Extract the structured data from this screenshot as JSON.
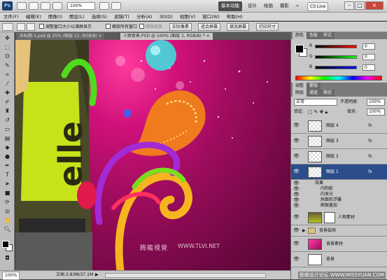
{
  "app": {
    "logo": "Ps",
    "zoom": "100%",
    "workspace_buttons": [
      "基本功能",
      "设计",
      "绘画",
      "摄影"
    ],
    "workspace_more": "»",
    "cs_live": "CS Live",
    "window_controls": [
      "–",
      "□",
      "×"
    ]
  },
  "menu": [
    "文件(F)",
    "编辑(E)",
    "图像(I)",
    "图层(L)",
    "选择(S)",
    "滤镜(T)",
    "分析(A)",
    "3D(D)",
    "视图(V)",
    "窗口(W)",
    "帮助(H)"
  ],
  "options": {
    "checkbox_resize": "调整窗口大小以满屏显示",
    "checkbox_all_windows": "缩放所有窗口",
    "checkbox_scrubby": "细微缩放",
    "btn_actual": "实际像素",
    "btn_fit": "适合屏幕",
    "btn_fill": "填充屏幕",
    "btn_print": "打印尺寸"
  },
  "documents": [
    {
      "label": "未标题-1.psd @ 25% (图层 11, RGB/8)",
      "close": "×"
    },
    {
      "label": "人物背景.PSD @ 100% (图层 1, RGB/8) *",
      "close": "×"
    }
  ],
  "canvas": {
    "watermark_left": "腾龍視覺",
    "watermark_right": "WWW.TLVI.NET",
    "shirt_text": "elle"
  },
  "status": {
    "zoom": "100%",
    "doc_info": "文档:3.83M/37.1M",
    "arrow": "▶"
  },
  "color_panel": {
    "tabs": [
      "颜色",
      "色板",
      "样式"
    ],
    "sliders": [
      {
        "label": "R",
        "value": "0"
      },
      {
        "label": "G",
        "value": "0"
      },
      {
        "label": "B",
        "value": "0"
      }
    ]
  },
  "layers_panel": {
    "top_tabs": [
      "调整",
      "蒙版"
    ],
    "tabs": [
      "图层",
      "通道",
      "路径"
    ],
    "blend_mode": "正常",
    "opacity_label": "不透明度:",
    "opacity_value": "100%",
    "lock_label": "锁定:",
    "fill_label": "填充:",
    "fill_value": "100%",
    "layers": [
      {
        "name": "图层 4",
        "fx": "fx",
        "thumb": "checker",
        "selected": false
      },
      {
        "name": "图层 3",
        "fx": "fx",
        "thumb": "checker",
        "selected": false
      },
      {
        "name": "图层 2",
        "fx": "fx",
        "thumb": "checker",
        "selected": false
      },
      {
        "name": "图层 1",
        "fx": "fx",
        "thumb": "checker",
        "selected": true
      }
    ],
    "effects_label": "效果",
    "effects": [
      "内阴影",
      "内发光",
      "斜面和浮雕",
      "图案叠加"
    ],
    "person_layer": "人物素材",
    "group_layer": "背景装饰",
    "bg_material": "背景素材",
    "background": "背景"
  },
  "site_watermark": "思缘设计论坛 WWW.MISSYUAN.COM"
}
